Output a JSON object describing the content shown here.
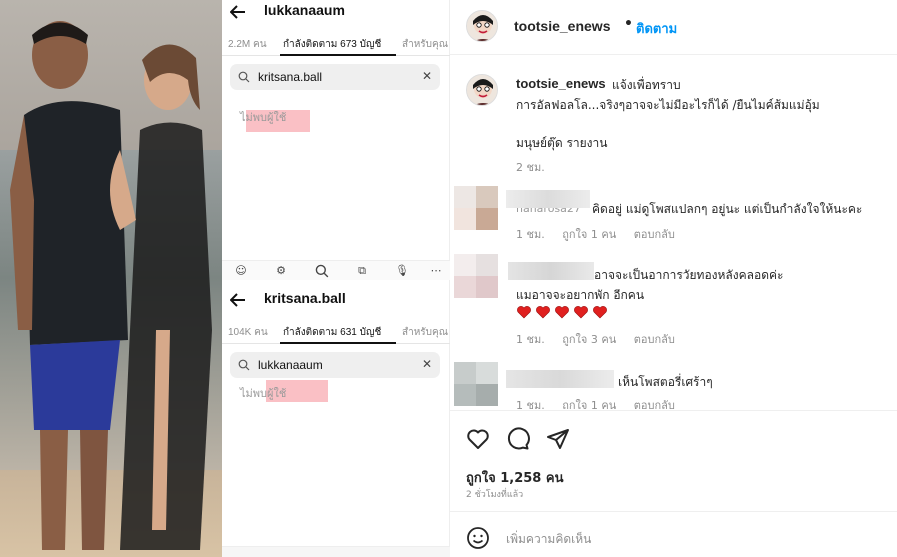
{
  "search_panel_1": {
    "title": "lukkanaaum",
    "tab_followers": "2.2M คน",
    "tab_following": "กำลังติดตาม 673 บัญชี",
    "tab_for_you": "สำหรับคุณ",
    "search_value": "kritsana.ball",
    "clear_icon": "✕",
    "no_user": "ไม่พบผู้ใช้"
  },
  "search_panel_2": {
    "title": "kritsana.ball",
    "tab_followers": "104K คน",
    "tab_following": "กำลังติดตาม 631 บัญชี",
    "tab_for_you": "สำหรับคุณ",
    "search_value": "lukkanaaum",
    "clear_icon": "✕",
    "no_user": "ไม่พบผู้ใช้"
  },
  "post": {
    "username": "tootsie_enews",
    "dot": "•",
    "follow_label": "ติดตาม",
    "caption": {
      "username": "tootsie_enews",
      "line1": "แจ้งเพื่อทราบ",
      "line2": "การอัลฟอลโล...จริงๆอาจจะไม่มีอะไรก็ได้ /ยืนไมค์ส้มแม่อุ้ม",
      "line3": "มนุษย์ตุ๊ด รายงาน",
      "time": "2 ชม."
    },
    "comments": [
      {
        "username_partial": "nanarosa27",
        "text": "คิดอยู่ แม่ดูโพสแปลกๆ อยู่นะ แต่เป็นกำลังใจให้นะคะ",
        "time": "1 ชม.",
        "likes": "ถูกใจ 1 คน",
        "reply": "ตอบกลับ"
      },
      {
        "text": "อาจจะเป็นอาการวัยทองหลังคลอดค่ะ",
        "text2": "แมอาจจะอยากพัก อีกคน",
        "hearts": 5,
        "time": "1 ชม.",
        "likes": "ถูกใจ 3 คน",
        "reply": "ตอบกลับ"
      },
      {
        "text": "เห็นโพสตอรี่เศร้าๆ",
        "time": "1 ชม.",
        "likes": "ถูกใจ 1 คน",
        "reply": "ตอบกลับ"
      }
    ],
    "likes_count": "ถูกใจ 1,258 คน",
    "time_ago": "2 ชั่วโมงที่แล้ว",
    "add_comment_placeholder": "เพิ่มความคิดเห็น"
  },
  "colors": {
    "accent_blue": "#0095f6",
    "highlight_pink": "#f58c96",
    "heart_red": "#e0201f"
  }
}
